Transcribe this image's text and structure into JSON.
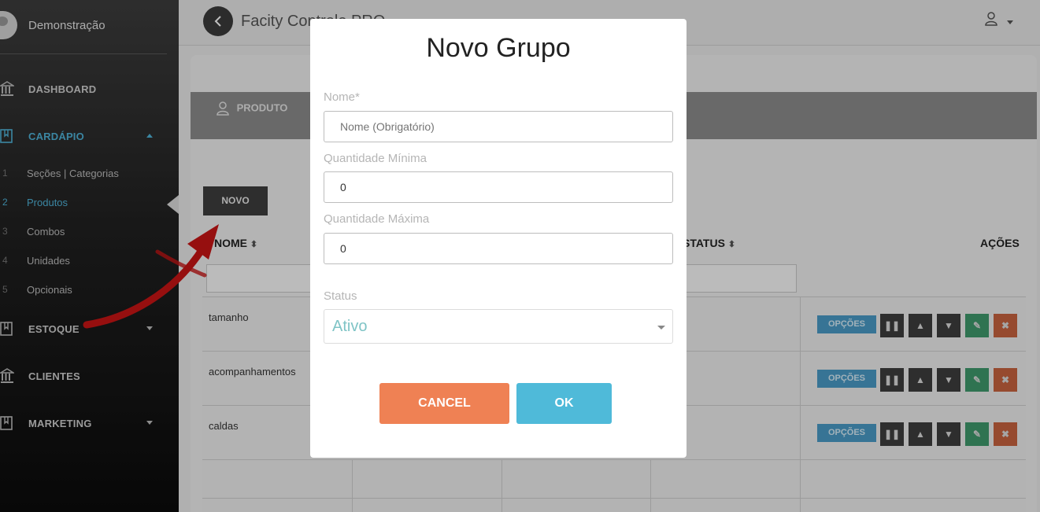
{
  "sidebar": {
    "username": "Demonstração",
    "items": [
      {
        "label": "DASHBOARD",
        "icon": "bank-icon"
      },
      {
        "label": "CARDÁPIO",
        "icon": "book-icon"
      },
      {
        "label": "ESTOQUE",
        "icon": "book-icon"
      },
      {
        "label": "CLIENTES",
        "icon": "bank-icon"
      },
      {
        "label": "MARKETING",
        "icon": "book-icon"
      }
    ],
    "submenu": [
      {
        "num": "1",
        "label": "Seções | Categorias"
      },
      {
        "num": "2",
        "label": "Produtos"
      },
      {
        "num": "3",
        "label": "Combos"
      },
      {
        "num": "4",
        "label": "Unidades"
      },
      {
        "num": "5",
        "label": "Opcionais"
      }
    ]
  },
  "header": {
    "title": "Facity Controle PRO",
    "back_icon": "chevron-left-icon",
    "user_icon": "user-icon"
  },
  "main": {
    "tab_label": "PRODUTO",
    "new_button": "NOVO",
    "columns": {
      "name": "NOME",
      "status": "STATUS",
      "actions": "AÇÕES"
    },
    "rows": [
      {
        "name": "tamanho"
      },
      {
        "name": "acompanhamentos"
      },
      {
        "name": "caldas"
      }
    ],
    "options_label": "OPÇÕES",
    "sort_glyph": "⬍"
  },
  "modal": {
    "title": "Novo Grupo",
    "name_label": "Nome*",
    "name_placeholder": "Nome (Obrigatório)",
    "min_label": "Quantidade Mínima",
    "min_value": "0",
    "max_label": "Quantidade Máxima",
    "max_value": "0",
    "status_label": "Status",
    "status_value": "Ativo",
    "cancel_label": "CANCEL",
    "ok_label": "OK"
  },
  "colors": {
    "accent": "#4fb3d9",
    "cancel": "#ef8154",
    "ok": "#4fbad9",
    "arrow": "#c81414"
  }
}
